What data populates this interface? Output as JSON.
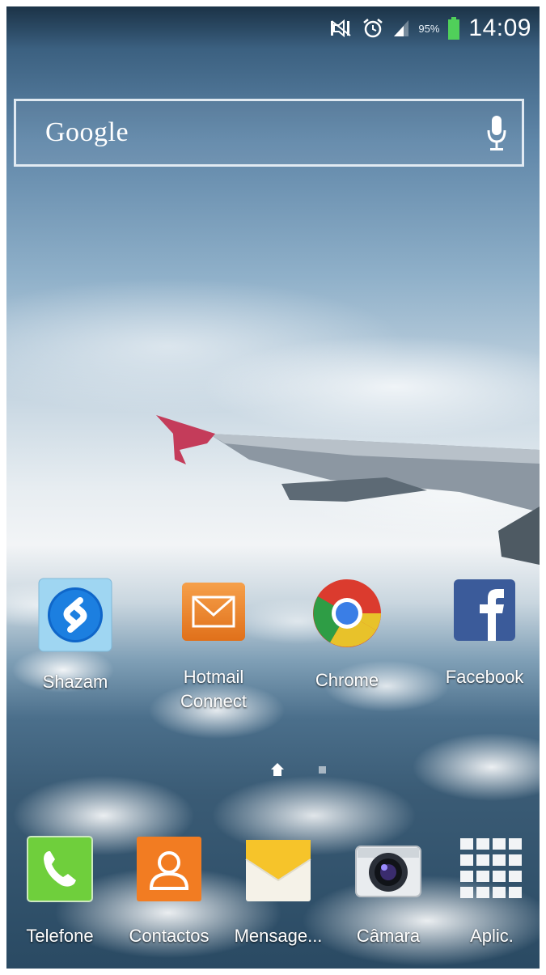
{
  "status_bar": {
    "battery_percent": "95%",
    "time": "14:09",
    "icons": [
      "mute-icon",
      "alarm-icon",
      "signal-icon",
      "battery-icon"
    ]
  },
  "search_widget": {
    "label": "Google",
    "icon": "microphone-icon"
  },
  "home_apps": [
    {
      "label": "Shazam",
      "icon": "shazam-icon"
    },
    {
      "label_line1": "Hotmail",
      "label_line2": "Connect",
      "icon": "hotmail-icon"
    },
    {
      "label": "Chrome",
      "icon": "chrome-icon"
    },
    {
      "label": "Facebook",
      "icon": "facebook-icon"
    }
  ],
  "dock": [
    {
      "label": "Telefone",
      "icon": "phone-icon"
    },
    {
      "label": "Contactos",
      "icon": "contacts-icon"
    },
    {
      "label": "Mensage...",
      "icon": "messages-icon"
    },
    {
      "label": "Câmara",
      "icon": "camera-icon"
    },
    {
      "label": "Aplic.",
      "icon": "apps-grid-icon"
    }
  ],
  "page_indicator": {
    "pages": 2,
    "current": "home"
  }
}
